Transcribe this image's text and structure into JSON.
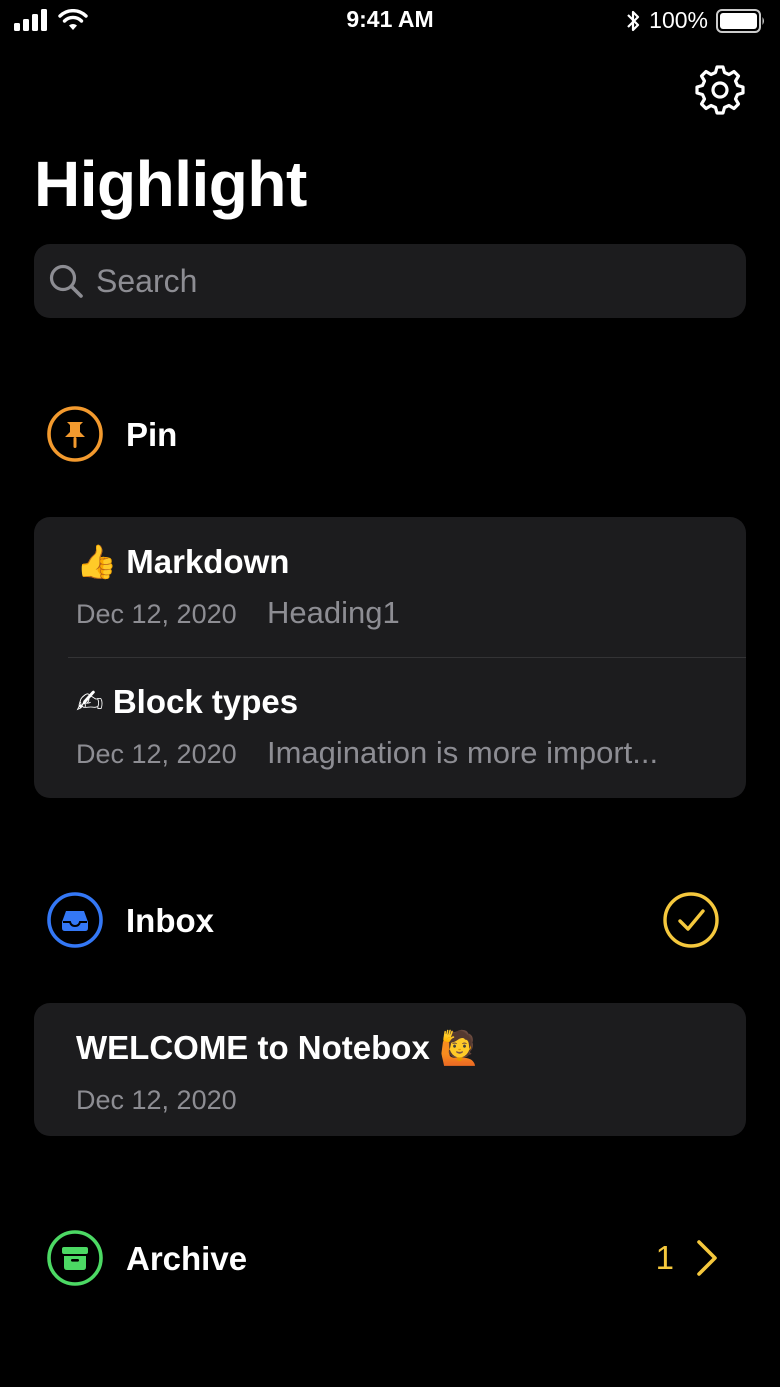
{
  "status_bar": {
    "time": "9:41 AM",
    "battery_percent": "100%",
    "icons": [
      "signal-icon",
      "wifi-icon",
      "bluetooth-icon",
      "battery-icon"
    ]
  },
  "header": {
    "title": "Highlight",
    "settings_icon": "gear-icon"
  },
  "search": {
    "placeholder": "Search",
    "icon": "search-icon"
  },
  "sections": {
    "pin": {
      "label": "Pin",
      "icon": "pin-icon",
      "color": "#f39a2e",
      "notes": [
        {
          "emoji": "👍",
          "title": "Markdown",
          "date": "Dec 12, 2020",
          "preview": "Heading1"
        },
        {
          "emoji": "✍",
          "title": "Block types",
          "date": "Dec 12, 2020",
          "preview": "Imagination is more import..."
        }
      ]
    },
    "inbox": {
      "label": "Inbox",
      "icon": "inbox-icon",
      "color": "#3478f6",
      "action_icon": "checkmark-circle-icon",
      "action_color": "#f5c83d",
      "notes": [
        {
          "title": "WELCOME to Notebox",
          "emoji": "🙋",
          "date": "Dec 12, 2020"
        }
      ]
    },
    "archive": {
      "label": "Archive",
      "icon": "archive-icon",
      "color": "#4cd964",
      "count": "1",
      "chevron_icon": "chevron-right-icon",
      "accent": "#f5c83d"
    }
  }
}
